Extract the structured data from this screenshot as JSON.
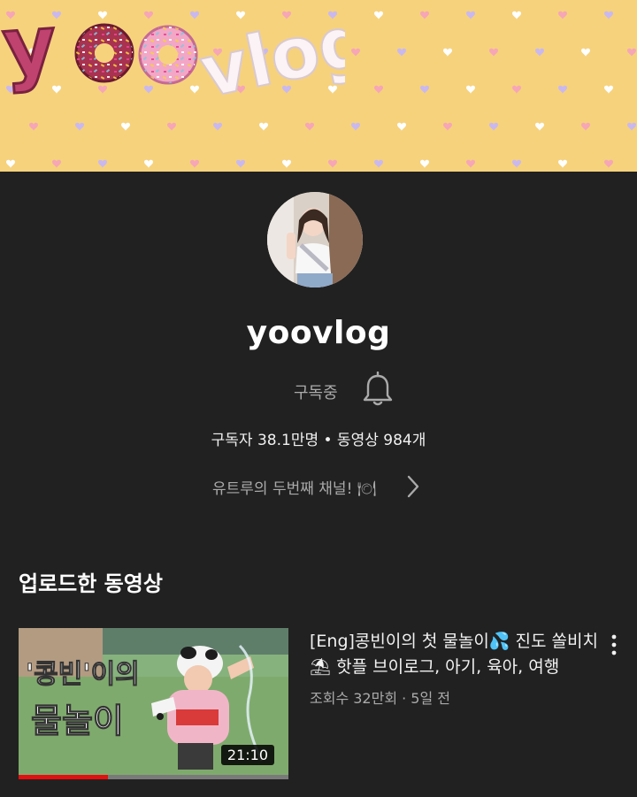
{
  "banner": {
    "logo_text": "yoovlog",
    "background": "#f6d27d"
  },
  "channel": {
    "name": "yoovlog",
    "subscribed_label": "구독중",
    "stats": "구독자 38.1만명 • 동영상 984개",
    "description": "유트루의 두번째 채널! 🍽"
  },
  "icons": {
    "bell": "bell-icon",
    "chevron": "chevron-right-icon",
    "more": "more-vert-icon"
  },
  "section": {
    "title": "업로드한 동영상"
  },
  "videos": [
    {
      "title": "[Eng]콩빈이의 첫 물놀이💦 진도 쏠비치⛱ 핫플 브이로그, 아기, 육아, 여행",
      "meta": "조회수 32만회 · 5일 전",
      "duration": "21:10",
      "thumbnail_text": [
        "'콩빈'이의",
        "물놀이"
      ],
      "watch_progress": 0.33
    }
  ],
  "colors": {
    "accent": "#e40f0f",
    "background": "#212121",
    "secondary_text": "#aaaaaa"
  }
}
